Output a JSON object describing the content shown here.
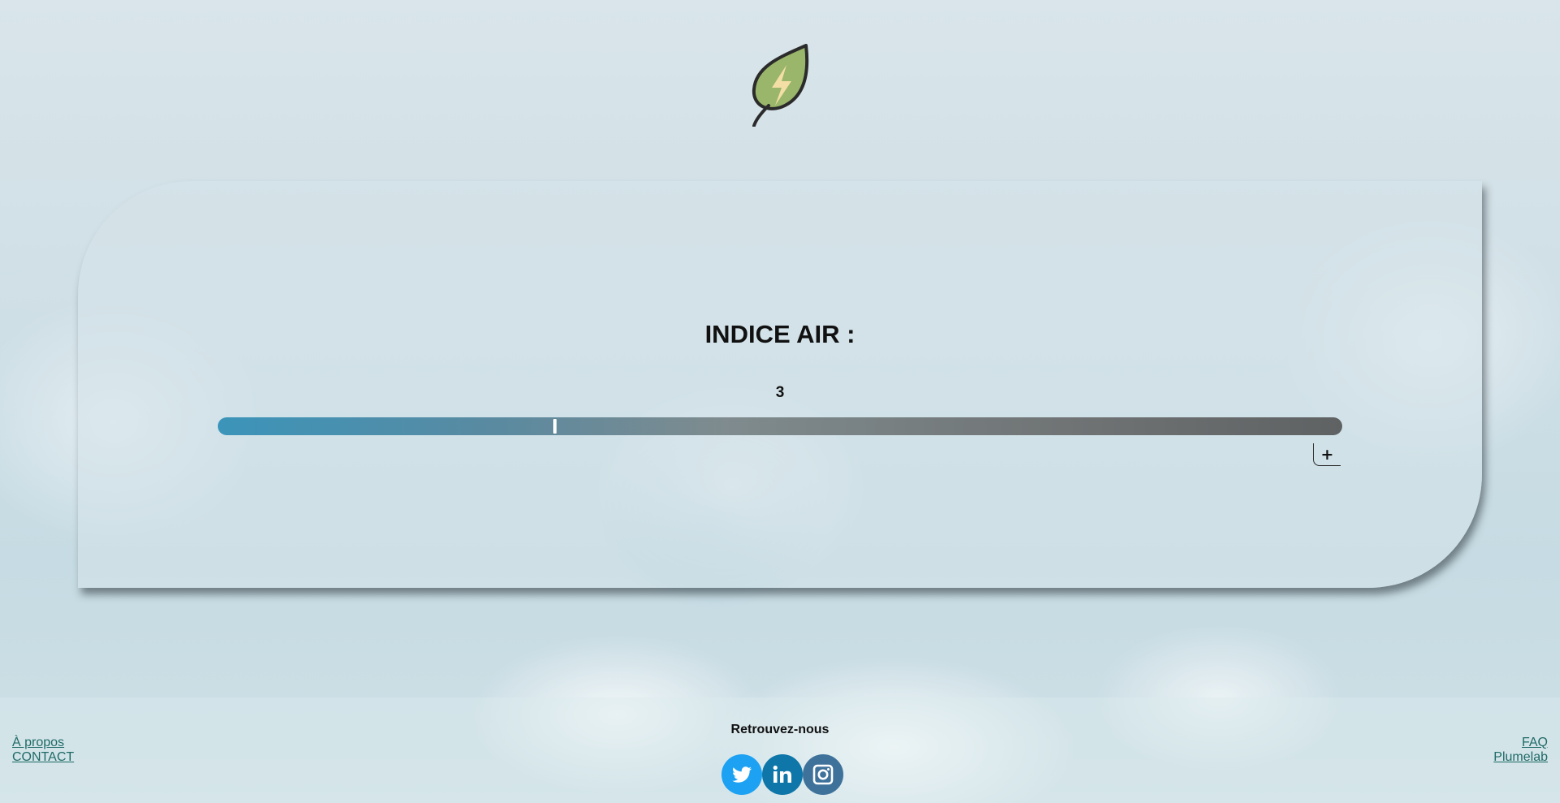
{
  "logo": {
    "icon": "leaf-lightning-icon",
    "colors": {
      "leaf": "#9ab66a",
      "bolt": "#f3dfa6",
      "outline": "#2b2b2b"
    }
  },
  "air_index": {
    "title": "INDICE AIR :",
    "value": "3",
    "level_fraction": 0.3,
    "more_button_label": "+",
    "gradient_colors": [
      "#3b94ba",
      "#7f8b8e",
      "#5f6263"
    ]
  },
  "footer": {
    "left_links": [
      "À propos",
      "CONTACT"
    ],
    "right_links": [
      "FAQ",
      "Plumelab"
    ],
    "social_title": "Retrouvez-nous",
    "social": [
      {
        "name": "twitter",
        "icon": "twitter-icon",
        "color": "#1da1f2"
      },
      {
        "name": "linkedin",
        "icon": "linkedin-icon",
        "color": "#0e76a8"
      },
      {
        "name": "instagram",
        "icon": "instagram-icon",
        "color": "#3f729b"
      }
    ]
  }
}
